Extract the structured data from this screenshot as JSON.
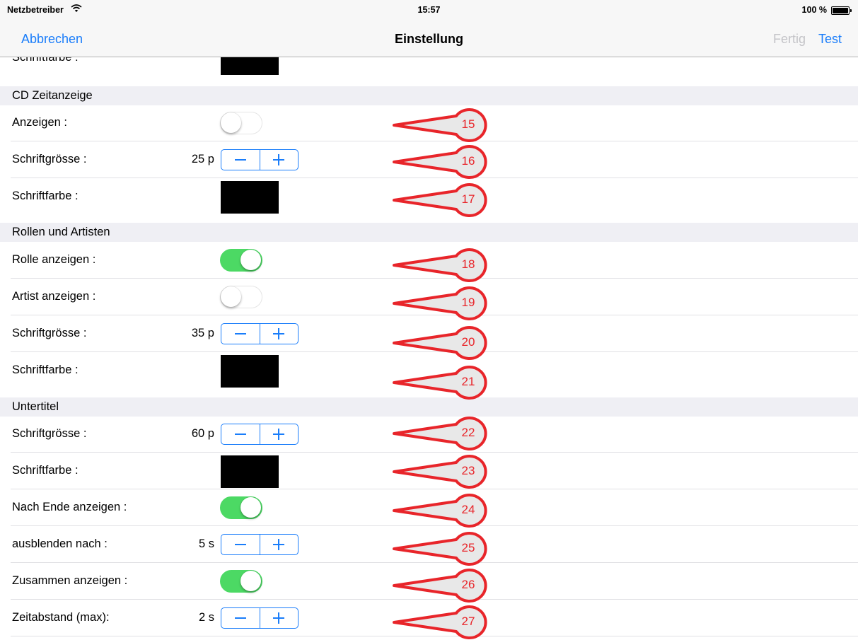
{
  "status": {
    "carrier": "Netzbetreiber",
    "time": "15:57",
    "battery": "100 %"
  },
  "nav": {
    "cancel": "Abbrechen",
    "title": "Einstellung",
    "done": "Fertig",
    "test": "Test"
  },
  "top_row": {
    "label": "Schriftfarbe :"
  },
  "sections": {
    "cd": "CD Zeitanzeige",
    "rollen": "Rollen und Artisten",
    "untertitel": "Untertitel"
  },
  "rows": {
    "cd_show": {
      "label": "Anzeigen :",
      "on": false
    },
    "cd_size": {
      "label": "Schriftgrösse :",
      "value": "25 p"
    },
    "cd_color": {
      "label": "Schriftfarbe :",
      "color": "#000000"
    },
    "role_show": {
      "label": "Rolle anzeigen :",
      "on": true
    },
    "artist_show": {
      "label": "Artist anzeigen :",
      "on": false
    },
    "role_size": {
      "label": "Schriftgrösse :",
      "value": "35 p"
    },
    "role_color": {
      "label": "Schriftfarbe :",
      "color": "#000000"
    },
    "sub_size": {
      "label": "Schriftgrösse :",
      "value": "60 p"
    },
    "sub_color": {
      "label": "Schriftfarbe :",
      "color": "#000000"
    },
    "sub_after_end": {
      "label": "Nach Ende anzeigen :",
      "on": true
    },
    "sub_fade": {
      "label": "ausblenden nach :",
      "value": "5 s"
    },
    "sub_together": {
      "label": "Zusammen anzeigen :",
      "on": true
    },
    "sub_gap": {
      "label": "Zeitabstand (max):",
      "value": "2 s"
    }
  },
  "callouts": [
    "15",
    "16",
    "17",
    "18",
    "19",
    "20",
    "21",
    "22",
    "23",
    "24",
    "25",
    "26",
    "27"
  ],
  "colors": {
    "accent": "#1a7dfa",
    "toggle_on": "#4cd964",
    "callout": "#e8252a"
  }
}
